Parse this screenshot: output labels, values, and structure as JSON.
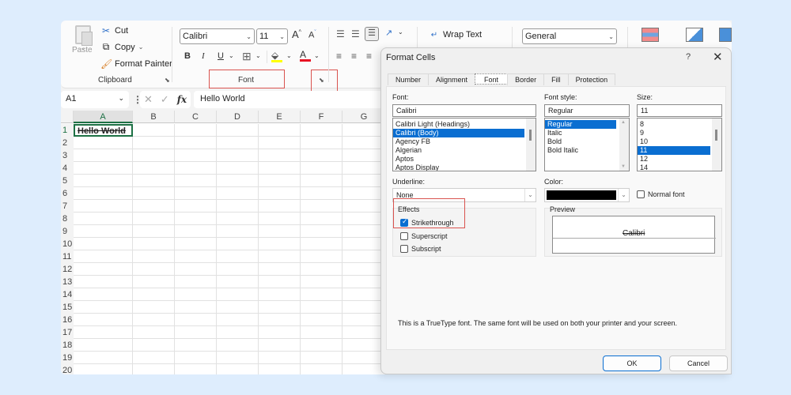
{
  "ribbon": {
    "clipboard": {
      "paste_label": "Paste",
      "cut_label": "Cut",
      "copy_label": "Copy",
      "format_painter_label": "Format Painter",
      "group_label": "Clipboard"
    },
    "font": {
      "font_name": "Calibri",
      "font_size": "11",
      "grow_label": "A",
      "shrink_label": "A",
      "bold_label": "B",
      "italic_label": "I",
      "underline_label": "U",
      "font_color_label": "A",
      "group_label": "Font",
      "highlight_color": "#ffff00",
      "font_color": "#e81123"
    },
    "alignment": {
      "wrap_text_label": "Wrap Text"
    },
    "number": {
      "format": "General"
    },
    "highlight_color": "#d9534f"
  },
  "formula_bar": {
    "name_box": "A1",
    "fx_label": "fx",
    "content": "Hello World"
  },
  "sheet": {
    "columns": [
      "A",
      "B",
      "C",
      "D",
      "E",
      "F",
      "G"
    ],
    "rows": [
      "1",
      "2",
      "3",
      "4",
      "5",
      "6",
      "7",
      "8",
      "9",
      "10",
      "11",
      "12",
      "13",
      "14",
      "15",
      "16",
      "17",
      "18",
      "19",
      "20"
    ],
    "active_cell": "A1",
    "cell_A1": "Hello World",
    "accent": "#1e7145"
  },
  "dialog": {
    "title": "Format Cells",
    "help_label": "?",
    "close_label": "✕",
    "tabs": [
      "Number",
      "Alignment",
      "Font",
      "Border",
      "Fill",
      "Protection"
    ],
    "active_tab": "Font",
    "font_label": "Font:",
    "font_value": "Calibri",
    "font_list": [
      "Calibri Light (Headings)",
      "Calibri (Body)",
      "Agency FB",
      "Algerian",
      "Aptos",
      "Aptos Display"
    ],
    "font_selected": "Calibri (Body)",
    "style_label": "Font style:",
    "style_value": "Regular",
    "style_list": [
      "Regular",
      "Italic",
      "Bold",
      "Bold Italic"
    ],
    "style_selected": "Regular",
    "size_label": "Size:",
    "size_value": "11",
    "size_list": [
      "8",
      "9",
      "10",
      "11",
      "12",
      "14"
    ],
    "size_selected": "11",
    "underline_label": "Underline:",
    "underline_value": "None",
    "color_label": "Color:",
    "color_value": "#000000",
    "normal_font_label": "Normal font",
    "normal_font_checked": false,
    "effects_label": "Effects",
    "strikethrough_label": "Strikethrough",
    "strikethrough_checked": true,
    "superscript_label": "Superscript",
    "superscript_checked": false,
    "subscript_label": "Subscript",
    "subscript_checked": false,
    "preview_label": "Preview",
    "preview_text": "Calibri",
    "info_text": "This is a TrueType font.  The same font will be used on both your printer and your screen.",
    "ok_label": "OK",
    "cancel_label": "Cancel",
    "accent": "#0a6ed1"
  }
}
